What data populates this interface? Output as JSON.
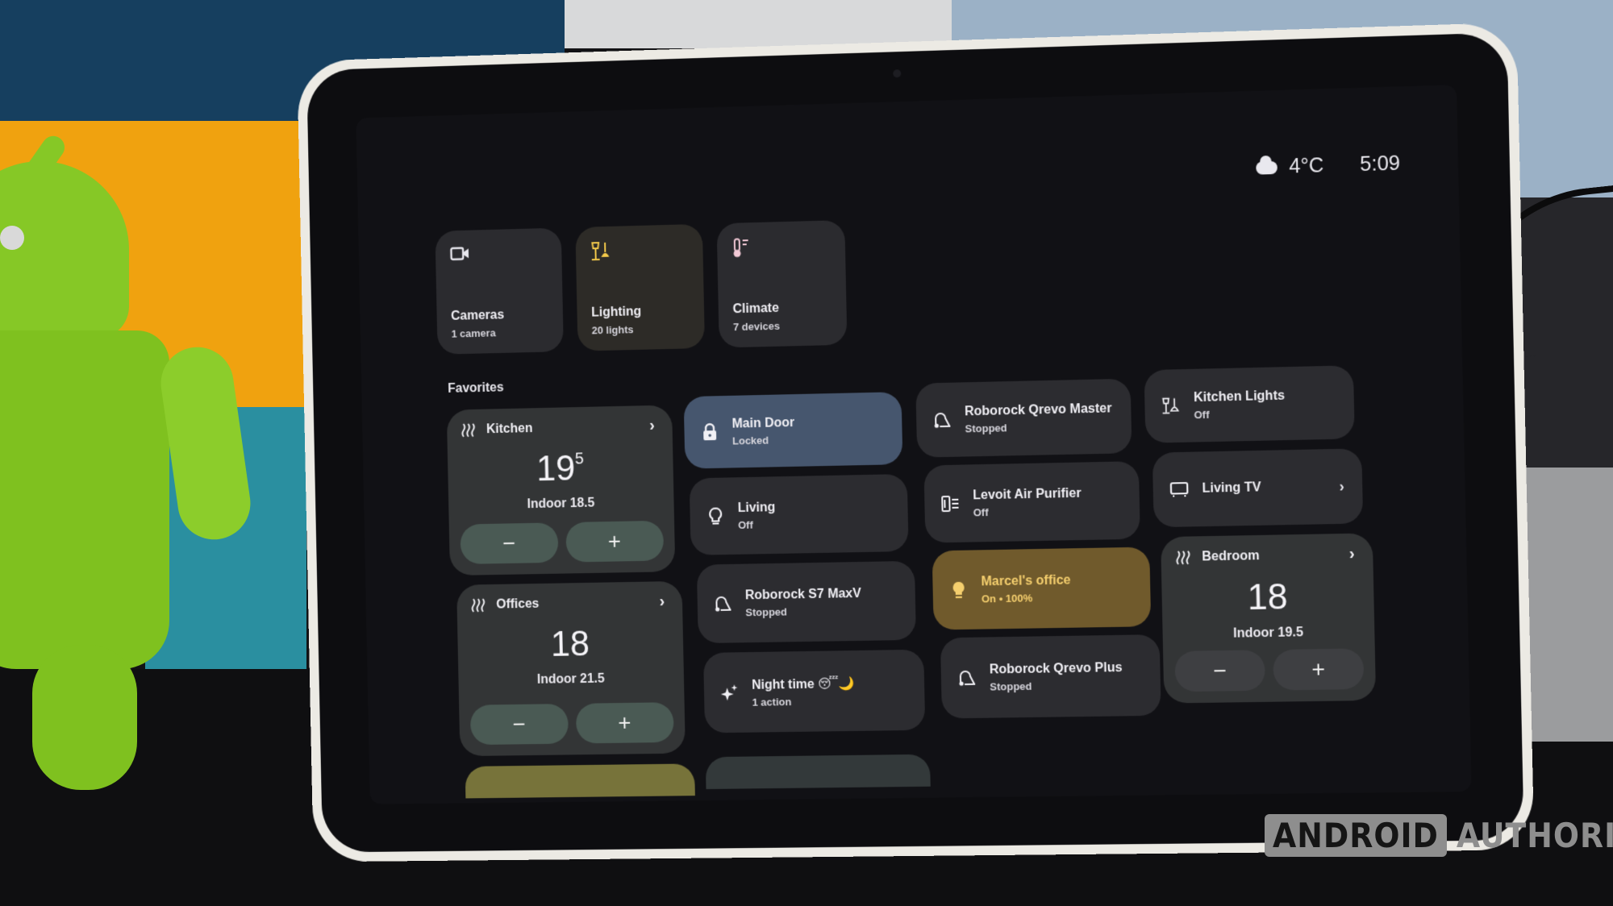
{
  "status_bar": {
    "weather_icon": "cloud-icon",
    "temperature": "4°C",
    "time": "5:09"
  },
  "categories": [
    {
      "title": "Cameras",
      "subtitle": "1 camera",
      "icon": "video-camera-icon"
    },
    {
      "title": "Lighting",
      "subtitle": "20 lights",
      "icon": "lamp-icon",
      "icon_color": "#f3c94a"
    },
    {
      "title": "Climate",
      "subtitle": "7 devices",
      "icon": "thermometer-icon",
      "icon_color": "#f2c9d6"
    }
  ],
  "favorites": {
    "label": "Favorites",
    "thermostats": [
      {
        "name": "Kitchen",
        "setpoint": "19",
        "setpoint_fraction": "5",
        "indoor": "Indoor 18.5",
        "minus": "−",
        "plus": "+"
      },
      {
        "name": "Offices",
        "setpoint": "18",
        "setpoint_fraction": "",
        "indoor": "Indoor 21.5",
        "minus": "−",
        "plus": "+"
      },
      {
        "name": "Bedroom",
        "setpoint": "18",
        "setpoint_fraction": "",
        "indoor": "Indoor 19.5",
        "minus": "−",
        "plus": "+"
      }
    ],
    "tiles": {
      "main_door": {
        "name": "Main Door",
        "state": "Locked",
        "icon": "lock-icon"
      },
      "living": {
        "name": "Living",
        "state": "Off",
        "icon": "lightbulb-icon"
      },
      "roborock_s7": {
        "name": "Roborock S7 MaxV",
        "state": "Stopped",
        "icon": "vacuum-icon"
      },
      "night_time": {
        "name": "Night time 😴🌙",
        "state": "1 action",
        "icon": "sparkle-icon"
      },
      "roborock_qrevo_master": {
        "name": "Roborock Qrevo Master",
        "state": "Stopped",
        "icon": "vacuum-icon"
      },
      "levoit": {
        "name": "Levoit Air Purifier",
        "state": "Off",
        "icon": "air-purifier-icon"
      },
      "marcels_office": {
        "name": "Marcel's office",
        "state": "On • 100%",
        "icon": "lightbulb-icon"
      },
      "roborock_qrevo_plus": {
        "name": "Roborock Qrevo Plus",
        "state": "Stopped",
        "icon": "vacuum-icon"
      },
      "kitchen_lights": {
        "name": "Kitchen Lights",
        "state": "Off",
        "icon": "lamp-icon"
      },
      "living_tv": {
        "name": "Living TV",
        "state": "",
        "icon": "tv-icon"
      }
    }
  },
  "colors": {
    "lock_tile": "#46566e",
    "light_on_tile": "#705a2c",
    "light_on_text": "#f5cf6e",
    "thermo_button": "#4a5a54",
    "peek_yellow": "#77733a"
  },
  "watermark": {
    "boxed": "ANDROID",
    "plain": "AUTHORITY"
  }
}
